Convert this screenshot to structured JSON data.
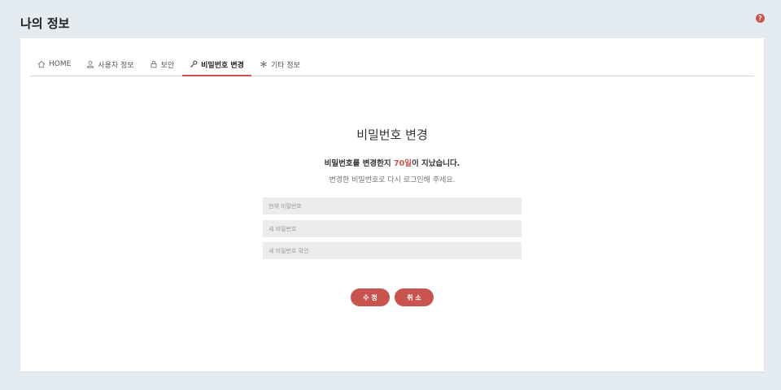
{
  "page": {
    "title": "나의 정보"
  },
  "header": {
    "help_icon": "question-circle-icon",
    "help_glyph": "?"
  },
  "tabs": [
    {
      "label": "HOME",
      "icon": "home-icon",
      "active": false
    },
    {
      "label": "사용자 정보",
      "icon": "user-icon",
      "active": false
    },
    {
      "label": "보안",
      "icon": "lock-icon",
      "active": false
    },
    {
      "label": "비밀번호 변경",
      "icon": "key-icon",
      "active": true
    },
    {
      "label": "기타 정보",
      "icon": "asterisk-icon",
      "active": false
    }
  ],
  "main": {
    "heading": "비밀번호 변경",
    "notice_prefix": "비밀번호를 변경한지 ",
    "notice_days": "70일",
    "notice_suffix": "이 지났습니다.",
    "subtext": "변경한 비밀번호로 다시 로그인해 주세요.",
    "fields": {
      "current_placeholder": "현재 비밀번호",
      "new_placeholder": "새 비밀번호",
      "confirm_placeholder": "새 비밀번호 확인"
    },
    "buttons": {
      "save": "수 정",
      "cancel": "취 소"
    }
  },
  "colors": {
    "accent": "#c9534f",
    "background": "#e4ebf1",
    "field": "#ebecee"
  }
}
